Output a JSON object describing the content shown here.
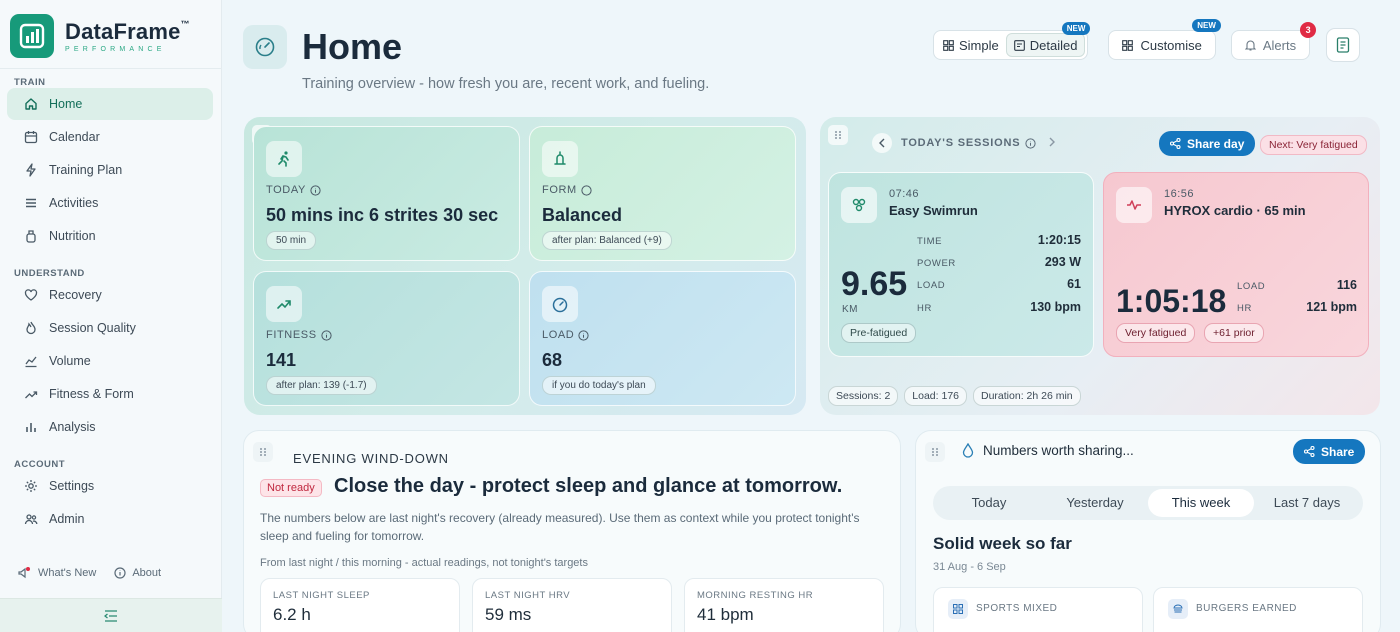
{
  "brand": {
    "name": "DataFrame",
    "tm": "™",
    "tagline": "PERFORMANCE"
  },
  "sidebar": {
    "sections": [
      {
        "label": "TRAIN",
        "items": [
          {
            "label": "Home",
            "icon": "home-icon",
            "active": true
          },
          {
            "label": "Calendar",
            "icon": "calendar-icon"
          },
          {
            "label": "Training Plan",
            "icon": "bolt-icon"
          },
          {
            "label": "Activities",
            "icon": "list-icon"
          },
          {
            "label": "Nutrition",
            "icon": "bottle-icon"
          }
        ]
      },
      {
        "label": "UNDERSTAND",
        "items": [
          {
            "label": "Recovery",
            "icon": "heart-icon"
          },
          {
            "label": "Session Quality",
            "icon": "flame-icon"
          },
          {
            "label": "Volume",
            "icon": "volume-chart-icon"
          },
          {
            "label": "Fitness & Form",
            "icon": "trend-icon"
          },
          {
            "label": "Analysis",
            "icon": "bar-chart-icon"
          }
        ]
      },
      {
        "label": "ACCOUNT",
        "items": [
          {
            "label": "Settings",
            "icon": "gear-icon"
          },
          {
            "label": "Admin",
            "icon": "users-icon"
          }
        ]
      }
    ],
    "footer": {
      "whats_new": "What's New",
      "about": "About"
    }
  },
  "header": {
    "title": "Home",
    "subtitle": "Training overview - how fresh you are, recent work, and fueling.",
    "view_simple": "Simple",
    "view_detailed": "Detailed",
    "detailed_badge": "NEW",
    "customise": "Customise",
    "customise_badge": "NEW",
    "alerts": "Alerts",
    "alerts_count": "3"
  },
  "overview": {
    "today": {
      "label": "TODAY",
      "value": "50 mins inc 6 strites 30 sec",
      "pill": "50 min"
    },
    "form": {
      "label": "FORM",
      "value": "Balanced",
      "pill": "after plan: Balanced (+9)"
    },
    "fitness": {
      "label": "FITNESS",
      "value": "141",
      "pill": "after plan: 139 (-1.7)"
    },
    "load": {
      "label": "LOAD",
      "value": "68",
      "pill": "if you do today's plan"
    }
  },
  "sessions": {
    "title": "TODAY'S SESSIONS",
    "share_label": "Share day",
    "next": "Next: Very fatigued",
    "cards": [
      {
        "time": "07:46",
        "name": "Easy Swimrun",
        "big": "9.65",
        "big_unit": "KM",
        "stats": [
          {
            "k": "TIME",
            "v": "1:20:15"
          },
          {
            "k": "POWER",
            "v": "293 W"
          },
          {
            "k": "LOAD",
            "v": "61"
          },
          {
            "k": "HR",
            "v": "130 bpm"
          }
        ],
        "pills": [
          "Pre-fatigued"
        ]
      },
      {
        "time": "16:56",
        "name": "HYROX cardio · 65 min",
        "big": "1:05:18",
        "stats": [
          {
            "k": "LOAD",
            "v": "116"
          },
          {
            "k": "HR",
            "v": "121 bpm"
          }
        ],
        "pills": [
          "Very fatigued",
          "+61 prior"
        ]
      }
    ],
    "summary": [
      "Sessions: 2",
      "Load: 176",
      "Duration: 2h 26 min"
    ]
  },
  "evening": {
    "kicker": "EVENING WIND-DOWN",
    "status": "Not ready",
    "title": "Close the day - protect sleep and glance at tomorrow.",
    "desc": "The numbers below are last night's recovery (already measured). Use them as context while you protect tonight's sleep and fueling for tomorrow.",
    "note": "From last night / this morning - actual readings, not tonight's targets",
    "cards": [
      {
        "label": "LAST NIGHT SLEEP",
        "value": "6.2 h"
      },
      {
        "label": "LAST NIGHT HRV",
        "value": "59 ms"
      },
      {
        "label": "MORNING RESTING HR",
        "value": "41 bpm"
      }
    ]
  },
  "share_numbers": {
    "title": "Numbers worth sharing...",
    "share_label": "Share",
    "tabs": [
      "Today",
      "Yesterday",
      "This week",
      "Last 7 days"
    ],
    "selected_tab": "This week",
    "headline": "Solid week so far",
    "range": "31 Aug - 6 Sep",
    "cards": [
      {
        "label": "SPORTS MIXED",
        "icon": "grid-icon"
      },
      {
        "label": "BURGERS EARNED",
        "icon": "burger-icon"
      }
    ]
  },
  "colors": {
    "accent": "#179a7a",
    "primary": "#1577bf",
    "danger": "#e02b44"
  }
}
